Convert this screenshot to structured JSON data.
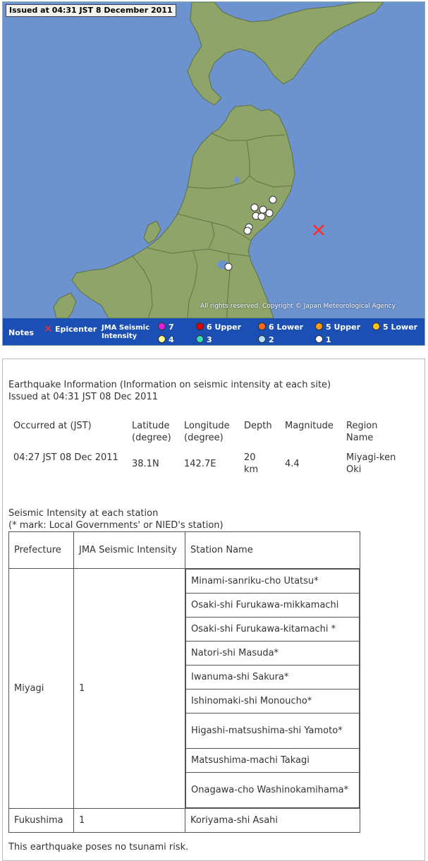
{
  "map": {
    "issued": "Issued at 04:31 JST  8 December 2011",
    "copyright": "All rights reserved. Copyright © Japan Meteorological Agency",
    "colors": {
      "sea": "#6d93cf",
      "land": "#8fa468",
      "legend_bg": "#1b4fb3",
      "epicenter": "#ff2a2a"
    },
    "legend": {
      "notes": "Notes",
      "epicenter_icon": "✕",
      "epicenter": "Epicenter",
      "jma_line1": "JMA Seismic",
      "jma_line2": "Intensity",
      "scale": [
        {
          "label": "7",
          "color": "#e020e0"
        },
        {
          "label": "6 Upper",
          "color": "#e00000"
        },
        {
          "label": "6 Lower",
          "color": "#ff6a1a"
        },
        {
          "label": "5 Upper",
          "color": "#ff9a1a"
        },
        {
          "label": "5 Lower",
          "color": "#ffc21a"
        },
        {
          "label": "4",
          "color": "#ffff99"
        },
        {
          "label": "3",
          "color": "#33dfc0"
        },
        {
          "label": "2",
          "color": "#aee0ff"
        },
        {
          "label": "1",
          "color": "#ffffff"
        }
      ]
    }
  },
  "info": {
    "title_line1": "Earthquake Information (Information on seismic intensity at each site)",
    "title_line2": "Issued at 04:31 JST 08 Dec 2011",
    "headers": {
      "occurred": "Occurred at (JST)",
      "latitude": "Latitude (degree)",
      "longitude": "Longitude (degree)",
      "depth": "Depth",
      "magnitude": "Magnitude",
      "region": "Region Name"
    },
    "values": {
      "occurred": "04:27 JST 08 Dec 2011",
      "latitude": "38.1N",
      "longitude": "142.7E",
      "depth": "20 km",
      "magnitude": "4.4",
      "region": "Miyagi-ken Oki"
    },
    "station_title_line1": "Seismic Intensity at each station",
    "station_title_line2": "(* mark: Local Governments' or NIED's station)",
    "station_headers": {
      "prefecture": "Prefecture",
      "intensity": "JMA Seismic Intensity",
      "station": "Station Name"
    },
    "prefectures": [
      {
        "name": "Miyagi",
        "intensity": "1",
        "stations": [
          "Minami-sanriku-cho Utatsu*",
          "Osaki-shi Furukawa-mikkamachi",
          "Osaki-shi Furukawa-kitamachi *",
          "Natori-shi Masuda*",
          "Iwanuma-shi Sakura*",
          "Ishinomaki-shi Monoucho*",
          "Higashi-matsushima-shi Yamoto*",
          "Matsushima-machi Takagi",
          "Onagawa-cho Washinokamihama*"
        ]
      },
      {
        "name": "Fukushima",
        "intensity": "1",
        "stations": [
          "Koriyama-shi Asahi"
        ]
      }
    ],
    "tsunami": "This earthquake poses no tsunami risk."
  }
}
